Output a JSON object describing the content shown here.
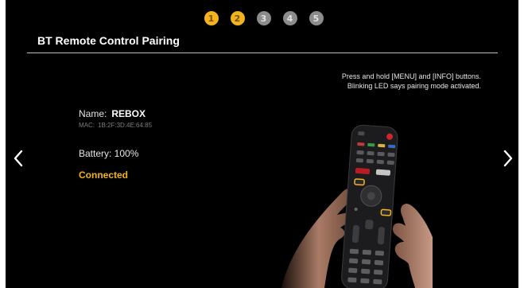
{
  "steps": [
    {
      "number": "1",
      "state": "active"
    },
    {
      "number": "2",
      "state": "active"
    },
    {
      "number": "3",
      "state": "inactive"
    },
    {
      "number": "4",
      "state": "inactive"
    },
    {
      "number": "5",
      "state": "inactive"
    }
  ],
  "header": {
    "title": "BT Remote Control Pairing"
  },
  "instructions": {
    "line1": "Press and hold [MENU] and [INFO] buttons.",
    "line2": "Blinking LED says pairing mode activated."
  },
  "device": {
    "name_label": "Name:",
    "name_value": "REBOX",
    "mac_label": "MAC:",
    "mac_value": "1B:2F:3D:4E:64:85",
    "battery": "Battery: 100%",
    "status": "Connected"
  },
  "navigation": {
    "prev_icon": "chevron-left-icon",
    "next_icon": "chevron-right-icon"
  },
  "colors": {
    "background": "#000000",
    "step_active": "#f2b31c",
    "step_inactive": "#8c8c8c",
    "status_connected": "#f2b31c"
  }
}
